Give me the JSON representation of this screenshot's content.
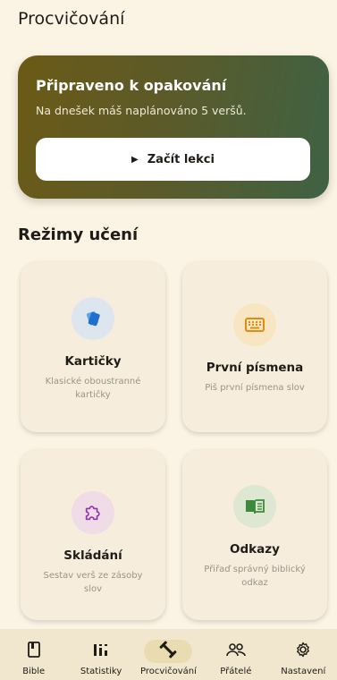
{
  "header": {
    "title": "Procvičování"
  },
  "hero": {
    "title": "Připraveno k opakování",
    "subtitle": "Na dnešek máš naplánováno 5 veršů.",
    "button_label": "Začít lekci"
  },
  "modes": {
    "title": "Režimy učení",
    "cards": [
      {
        "title": "Kartičky",
        "desc": "Klasické oboustranné kartičky",
        "icon": "cards-icon",
        "icon_bg": "#dde6ee",
        "icon_color": "#2d7bd6"
      },
      {
        "title": "První písmena",
        "desc": "Piš první písmena slov",
        "icon": "keyboard-icon",
        "icon_bg": "#f8e6c3",
        "icon_color": "#e28b11"
      },
      {
        "title": "Skládání",
        "desc": "Sestav verš ze zásoby slov",
        "icon": "puzzle-icon",
        "icon_bg": "#efdce6",
        "icon_color": "#9a32b5"
      },
      {
        "title": "Odkazy",
        "desc": "Přiřaď správný biblický odkaz",
        "icon": "book-icon",
        "icon_bg": "#dde7d2",
        "icon_color": "#3c8a3b"
      }
    ]
  },
  "nav": {
    "items": [
      {
        "label": "Bible",
        "icon": "bible-icon"
      },
      {
        "label": "Statistiky",
        "icon": "stats-icon"
      },
      {
        "label": "Procvičování",
        "icon": "dumbbell-icon",
        "active": true
      },
      {
        "label": "Přátelé",
        "icon": "people-icon"
      },
      {
        "label": "Nastavení",
        "icon": "gear-icon"
      }
    ]
  }
}
